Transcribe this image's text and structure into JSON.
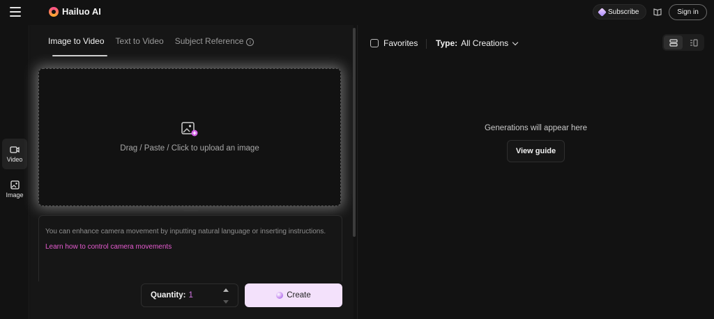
{
  "header": {
    "brand": "Hailuo AI",
    "subscribe_label": "Subscribe",
    "signin_label": "Sign in"
  },
  "rail": {
    "items": [
      {
        "label": "Video",
        "icon": "video-icon",
        "active": true
      },
      {
        "label": "Image",
        "icon": "image-icon",
        "active": false
      }
    ]
  },
  "left": {
    "tabs": [
      {
        "label": "Image to Video",
        "active": true
      },
      {
        "label": "Text to Video",
        "active": false
      },
      {
        "label": "Subject Reference",
        "active": false
      }
    ],
    "upload_text": "Drag / Paste / Click to upload an image",
    "prompt_text": "You can enhance camera movement by inputting natural language or inserting instructions.",
    "prompt_link": "Learn how to control camera movements",
    "quantity_label": "Quantity:",
    "quantity_value": "1",
    "create_label": "Create"
  },
  "right": {
    "favorites_label": "Favorites",
    "type_label": "Type:",
    "type_value": "All Creations",
    "empty_text": "Generations will appear here",
    "guide_label": "View guide"
  },
  "colors": {
    "background": "#121212",
    "accent_link": "#e65bd0",
    "create_button": "#f3e1fb"
  }
}
